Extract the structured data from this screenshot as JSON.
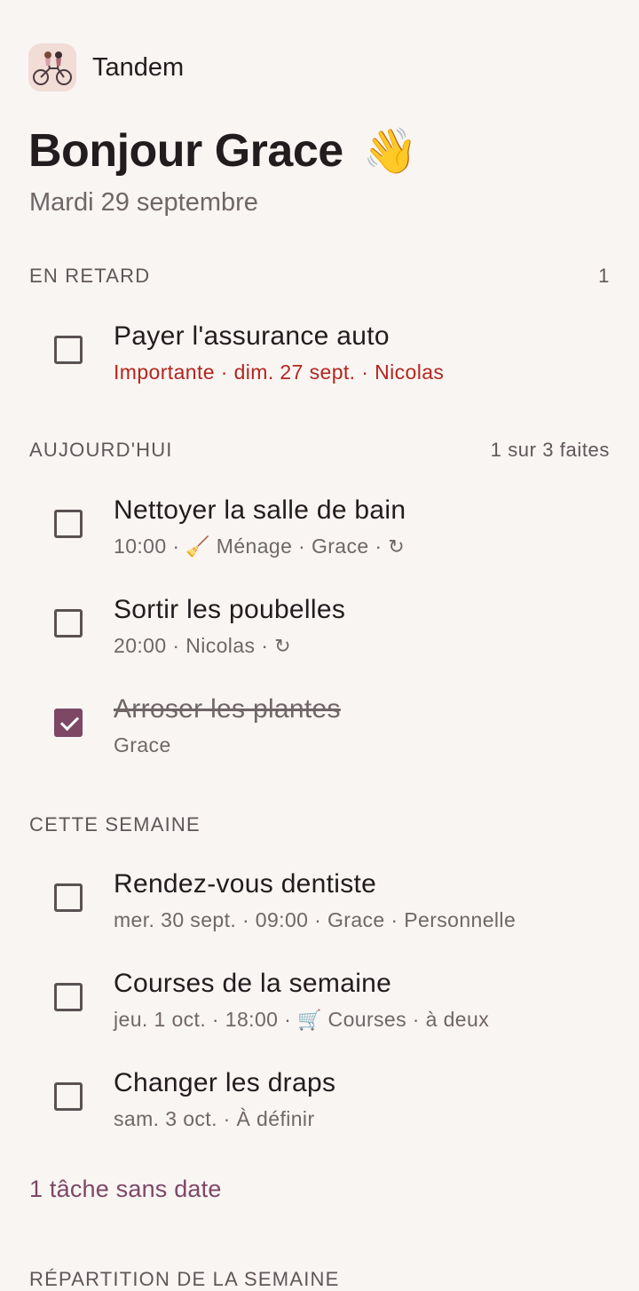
{
  "app": {
    "name": "Tandem",
    "logo_icon": "tandem-bicycle-icon"
  },
  "greeting": {
    "text": "Bonjour Grace",
    "emoji": "👋"
  },
  "date": "Mardi 29 septembre",
  "sections": {
    "overdue": {
      "title": "EN RETARD",
      "count": "1",
      "tasks": [
        {
          "title": "Payer l'assurance auto",
          "meta": "Importante · dim. 27 sept. · Nicolas",
          "done": false
        }
      ]
    },
    "today": {
      "title": "AUJOURD'HUI",
      "count": "1 sur 3 faites",
      "tasks": [
        {
          "title": "Nettoyer la salle de bain",
          "meta_before": "10:00 · ",
          "meta_icon": "🧹",
          "meta_after": " Ménage · Grace · ",
          "repeat": "↻",
          "done": false
        },
        {
          "title": "Sortir les poubelles",
          "meta_before": "20:00 · Nicolas · ",
          "repeat": "↻",
          "done": false
        },
        {
          "title": "Arroser les plantes",
          "meta": "Grace",
          "done": true
        }
      ]
    },
    "week": {
      "title": "CETTE SEMAINE",
      "tasks": [
        {
          "title": "Rendez-vous dentiste",
          "meta": "mer. 30 sept. · 09:00 · Grace · Personnelle",
          "done": false
        },
        {
          "title": "Courses de la semaine",
          "meta_before": "jeu. 1 oct. · 18:00 · ",
          "meta_icon": "🛒",
          "meta_after": " Courses · à deux",
          "done": false
        },
        {
          "title": "Changer les draps",
          "meta": "sam. 3 oct. · À définir",
          "done": false
        }
      ]
    }
  },
  "undated_link": "1 tâche sans date",
  "next_section_title": "RÉPARTITION DE LA SEMAINE",
  "colors": {
    "accent": "#7d4766",
    "overdue": "#b3261e",
    "background": "#f9f5f3"
  }
}
